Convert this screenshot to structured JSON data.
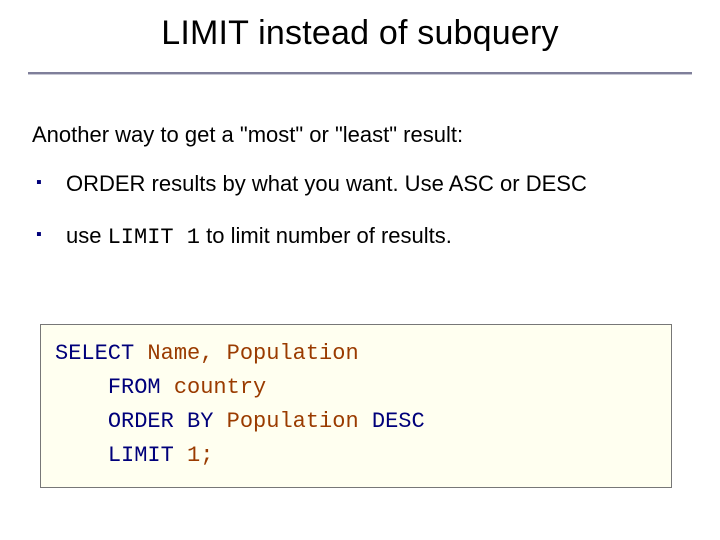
{
  "title": "LIMIT instead of subquery",
  "intro": "Another way to get a \"most\" or \"least\" result:",
  "bullets": [
    {
      "text": "ORDER results by what you want.  Use ASC or DESC"
    },
    {
      "prefix": "use ",
      "code": "LIMIT 1",
      "suffix": " to limit number of results."
    }
  ],
  "code": {
    "l1_kw": "SELECT",
    "l1_rest": " Name, Population",
    "l2_kw": "FROM",
    "l2_rest": " country",
    "l3_kw": "ORDER BY",
    "l3_mid": " Population ",
    "l3_kw2": "DESC",
    "l4_kw": "LIMIT",
    "l4_rest": " 1;"
  }
}
